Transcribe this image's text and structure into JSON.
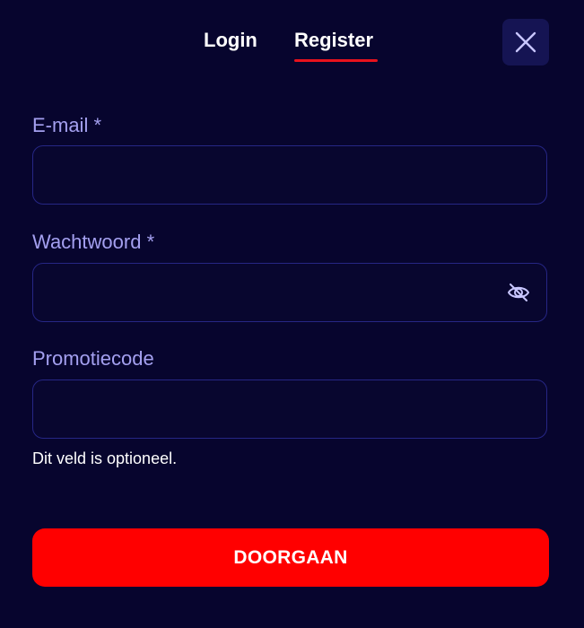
{
  "tabs": [
    {
      "label": "Login",
      "active": false
    },
    {
      "label": "Register",
      "active": true
    }
  ],
  "colors": {
    "background": "#07052e",
    "active_underline": "#e8121d",
    "label": "#a4a0f0",
    "input_border": "#262685",
    "close_button_bg": "#151453",
    "primary_button": "#ff0000"
  },
  "close_button": {
    "icon": "close-icon"
  },
  "form": {
    "email": {
      "label": "E-mail *",
      "value": "",
      "placeholder": ""
    },
    "password": {
      "label": "Wachtwoord *",
      "value": "",
      "placeholder": "",
      "toggle_icon": "eye-off-icon"
    },
    "promo": {
      "label": "Promotiecode",
      "value": "",
      "placeholder": "",
      "helper": "Dit veld is optioneel."
    }
  },
  "submit_label": "DOORGAAN"
}
